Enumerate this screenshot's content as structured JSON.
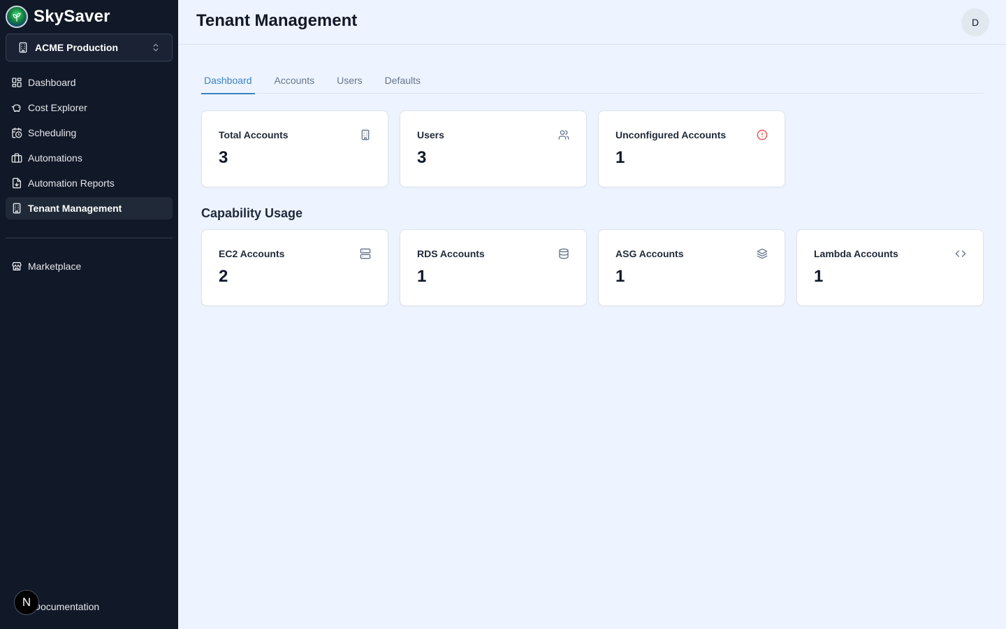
{
  "brand": {
    "name": "SkySaver"
  },
  "tenant_selector": {
    "label": "ACME Production"
  },
  "sidebar": {
    "items": [
      {
        "label": "Dashboard",
        "icon": "layout-dashboard-icon"
      },
      {
        "label": "Cost Explorer",
        "icon": "piggy-bank-icon"
      },
      {
        "label": "Scheduling",
        "icon": "calendar-clock-icon"
      },
      {
        "label": "Automations",
        "icon": "briefcase-icon"
      },
      {
        "label": "Automation Reports",
        "icon": "file-report-icon"
      },
      {
        "label": "Tenant Management",
        "icon": "building-icon",
        "active": true
      }
    ],
    "secondary": [
      {
        "label": "Marketplace",
        "icon": "store-icon"
      }
    ],
    "footer": {
      "documentation_label": "Documentation",
      "badge_letter": "N"
    }
  },
  "header": {
    "title": "Tenant Management",
    "avatar_initial": "D"
  },
  "tabs": [
    {
      "label": "Dashboard",
      "active": true
    },
    {
      "label": "Accounts"
    },
    {
      "label": "Users"
    },
    {
      "label": "Defaults"
    }
  ],
  "summary_cards": [
    {
      "title": "Total Accounts",
      "value": "3",
      "icon": "building-icon"
    },
    {
      "title": "Users",
      "value": "3",
      "icon": "users-icon"
    },
    {
      "title": "Unconfigured Accounts",
      "value": "1",
      "icon": "alert-circle-icon"
    }
  ],
  "capability_section": {
    "title": "Capability Usage"
  },
  "capability_cards": [
    {
      "title": "EC2 Accounts",
      "value": "2",
      "icon": "server-icon"
    },
    {
      "title": "RDS Accounts",
      "value": "1",
      "icon": "database-icon"
    },
    {
      "title": "ASG Accounts",
      "value": "1",
      "icon": "layers-icon"
    },
    {
      "title": "Lambda Accounts",
      "value": "1",
      "icon": "code-icon"
    }
  ],
  "colors": {
    "sidebar_bg": "#111827",
    "page_bg": "#eef4ff",
    "accent": "#3b82c4",
    "alert": "#ef4444"
  }
}
